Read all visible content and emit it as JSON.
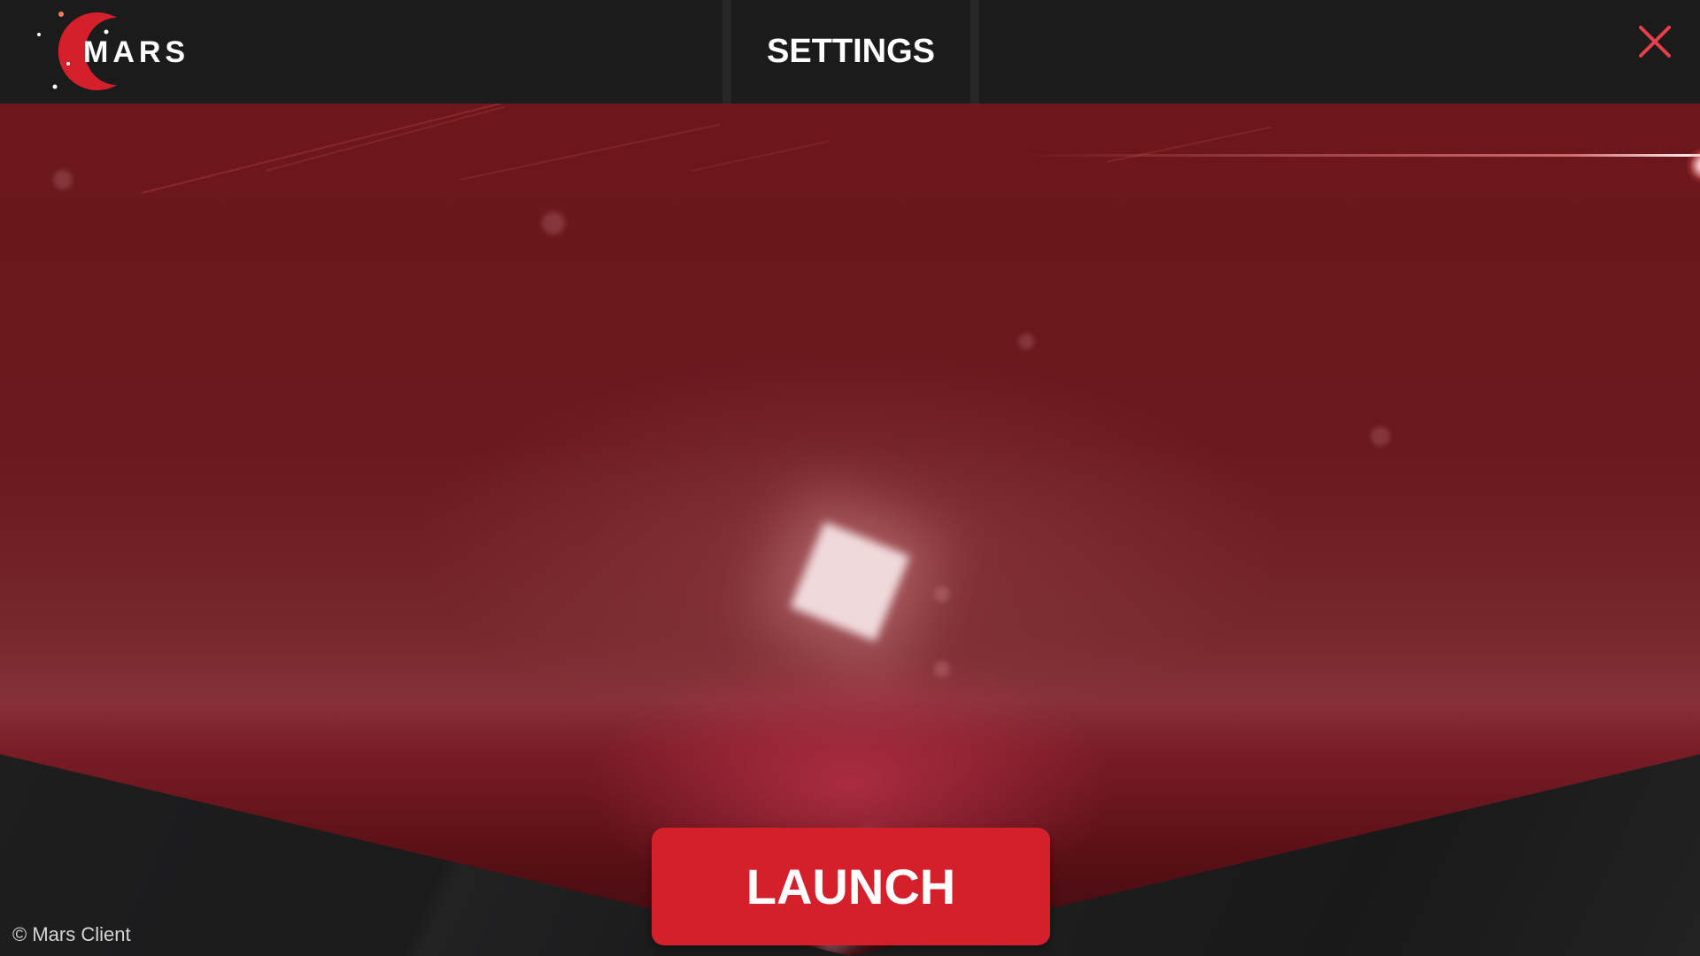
{
  "app": {
    "name": "Mars Client"
  },
  "header": {
    "logo_text": "MARS",
    "tab_settings_label": "SETTINGS",
    "close_icon": "close-x"
  },
  "main": {
    "launch_label": "LAUNCH"
  },
  "footer": {
    "copyright": "© Mars Client"
  },
  "colors": {
    "accent": "#d5202c",
    "topbar_bg": "#1b1b1c",
    "close_icon": "#e8404a",
    "scene_red": "#6b171b"
  }
}
